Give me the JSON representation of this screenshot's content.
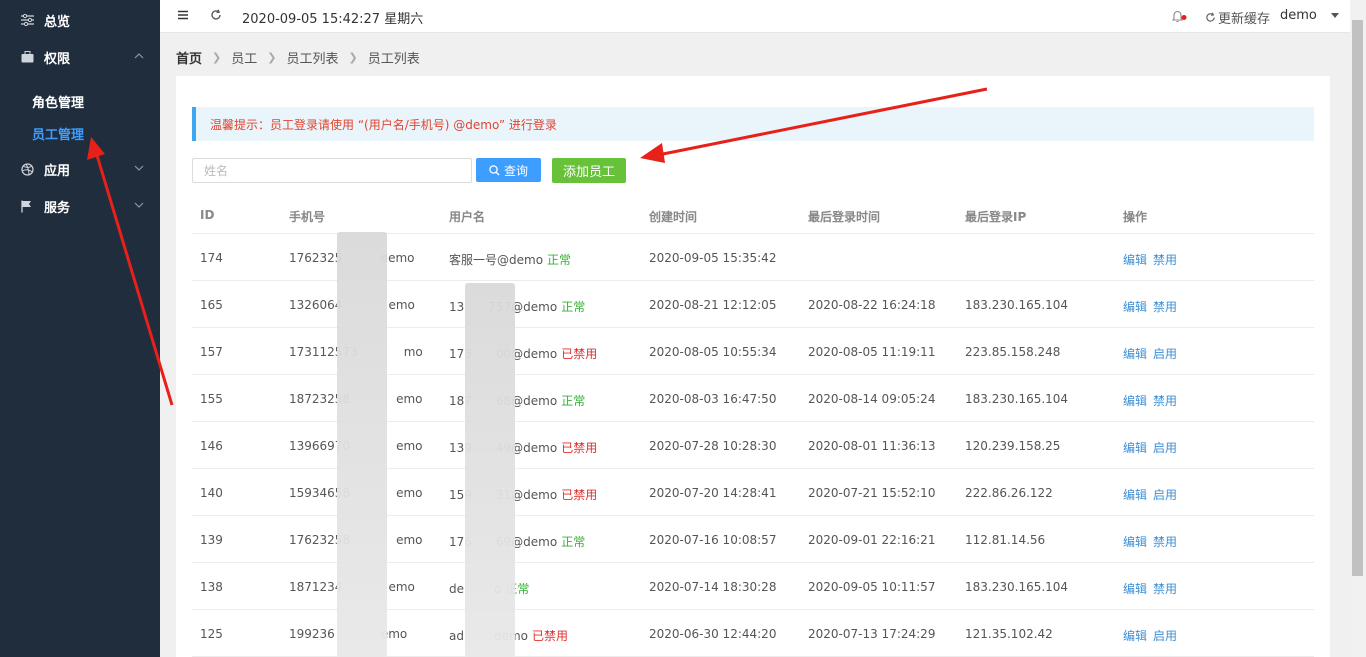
{
  "sidebar": {
    "items": [
      {
        "label": "总览",
        "icon": "sliders-icon"
      },
      {
        "label": "权限",
        "icon": "briefcase-icon"
      },
      {
        "label": "应用",
        "icon": "dribbble-icon"
      },
      {
        "label": "服务",
        "icon": "flag-icon"
      }
    ],
    "sub_items": [
      {
        "label": "角色管理"
      },
      {
        "label": "员工管理"
      }
    ]
  },
  "topbar": {
    "datetime": "2020-09-05 15:42:27 星期六",
    "cache_label": "更新缓存",
    "user": "demo"
  },
  "breadcrumb": [
    "首页",
    "员工",
    "员工列表",
    "员工列表"
  ],
  "tip": "温馨提示：员工登录请使用 “(用户名/手机号) @demo” 进行登录",
  "search": {
    "placeholder": "姓名",
    "query_label": "查询",
    "add_label": "添加员工"
  },
  "table": {
    "headers": [
      "ID",
      "手机号",
      "用户名",
      "创建时间",
      "最后登录时间",
      "最后登录IP",
      "操作"
    ],
    "rows": [
      {
        "id": "174",
        "phone": "1762325",
        "phone_tail": "demo",
        "user": "客服一号@demo",
        "status": "正常",
        "created": "2020-09-05 15:35:42",
        "last_login": "",
        "ip": "",
        "edit": "编辑",
        "toggle": "禁用"
      },
      {
        "id": "165",
        "phone": "1326064",
        "phone_tail": "emo",
        "user": "13",
        "user_tail": "757@demo",
        "status": "正常",
        "created": "2020-08-21 12:12:05",
        "last_login": "2020-08-22 16:24:18",
        "ip": "183.230.165.104",
        "edit": "编辑",
        "toggle": "禁用"
      },
      {
        "id": "157",
        "phone": "173112573",
        "phone_tail": "mo",
        "user": "173",
        "user_tail": "00@demo",
        "status": "已禁用",
        "created": "2020-08-05 10:55:34",
        "last_login": "2020-08-05 11:19:11",
        "ip": "223.85.158.248",
        "edit": "编辑",
        "toggle": "启用"
      },
      {
        "id": "155",
        "phone": "18723258",
        "phone_tail": "emo",
        "user": "187",
        "user_tail": "68@demo",
        "status": "正常",
        "created": "2020-08-03 16:47:50",
        "last_login": "2020-08-14 09:05:24",
        "ip": "183.230.165.104",
        "edit": "编辑",
        "toggle": "禁用"
      },
      {
        "id": "146",
        "phone": "13966970",
        "phone_tail": "emo",
        "user": "139",
        "user_tail": "49@demo",
        "status": "已禁用",
        "created": "2020-07-28 10:28:30",
        "last_login": "2020-08-01 11:36:13",
        "ip": "120.239.158.25",
        "edit": "编辑",
        "toggle": "启用"
      },
      {
        "id": "140",
        "phone": "15934658",
        "phone_tail": "emo",
        "user": "159",
        "user_tail": "31@demo",
        "status": "已禁用",
        "created": "2020-07-20 14:28:41",
        "last_login": "2020-07-21 15:52:10",
        "ip": "222.86.26.122",
        "edit": "编辑",
        "toggle": "启用"
      },
      {
        "id": "139",
        "phone": "17623258",
        "phone_tail": "emo",
        "user": "176",
        "user_tail": "69@demo",
        "status": "正常",
        "created": "2020-07-16 10:08:57",
        "last_login": "2020-09-01 22:16:21",
        "ip": "112.81.14.56",
        "edit": "编辑",
        "toggle": "禁用"
      },
      {
        "id": "138",
        "phone": "1871234",
        "phone_tail": "emo",
        "user": "de",
        "user_tail": "o",
        "status": "正常",
        "created": "2020-07-14 18:30:28",
        "last_login": "2020-09-05 10:11:57",
        "ip": "183.230.165.104",
        "edit": "编辑",
        "toggle": "禁用"
      },
      {
        "id": "125",
        "phone": "199236",
        "phone_tail": "emo",
        "user": "ad",
        "user_tail": "demo",
        "status": "已禁用",
        "created": "2020-06-30 12:44:20",
        "last_login": "2020-07-13 17:24:29",
        "ip": "121.35.102.42",
        "edit": "编辑",
        "toggle": "启用"
      }
    ]
  },
  "colors": {
    "sidebar_bg": "#1f2d3d",
    "accent": "#3d9eff",
    "add_green": "#67c23a",
    "ok_green": "#34b234",
    "ban_red": "#e0302f",
    "arrow_red": "#e8201a"
  }
}
